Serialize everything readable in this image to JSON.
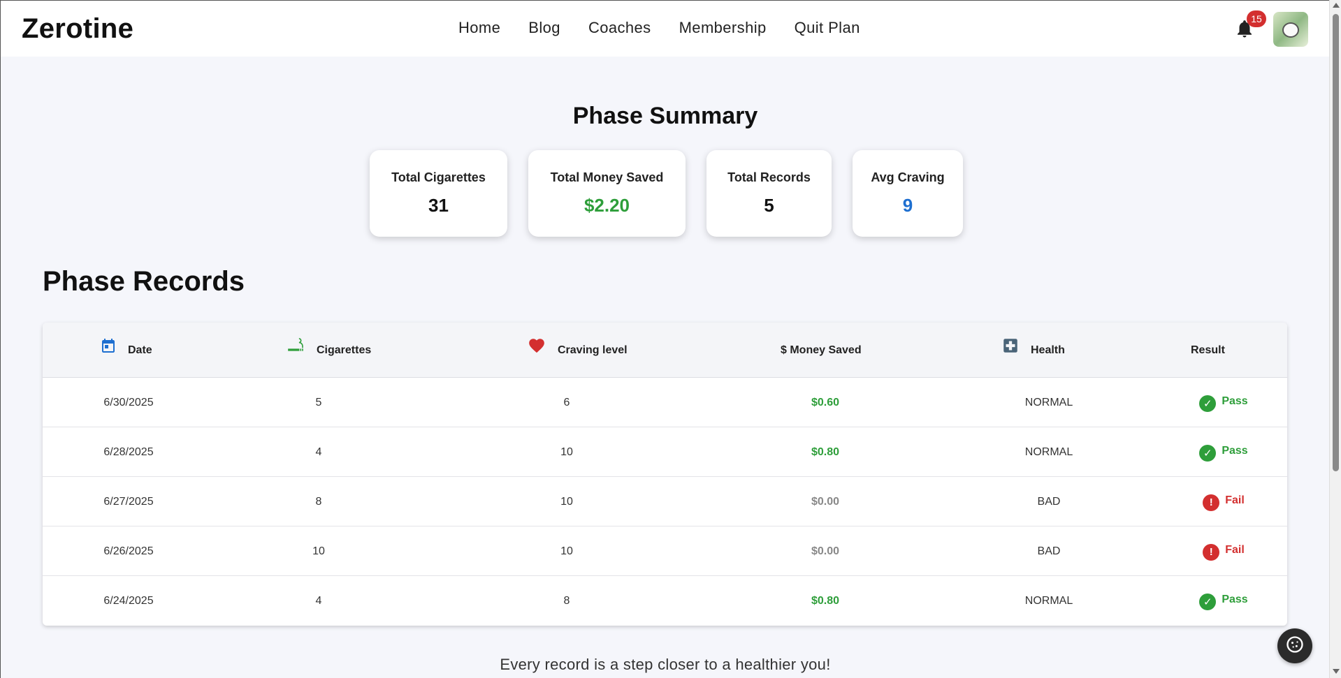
{
  "brand": {
    "logo": "Zerotine"
  },
  "nav": {
    "items": [
      {
        "label": "Home"
      },
      {
        "label": "Blog"
      },
      {
        "label": "Coaches"
      },
      {
        "label": "Membership"
      },
      {
        "label": "Quit Plan"
      }
    ]
  },
  "header": {
    "notification_count": "15"
  },
  "summary": {
    "title": "Phase Summary",
    "cards": [
      {
        "label": "Total Cigarettes",
        "value": "31"
      },
      {
        "label": "Total Money Saved",
        "value": "$2.20"
      },
      {
        "label": "Total Records",
        "value": "5"
      },
      {
        "label": "Avg Craving",
        "value": "9"
      }
    ]
  },
  "records": {
    "title": "Phase Records",
    "columns": {
      "date": "Date",
      "cigarettes": "Cigarettes",
      "craving": "Craving level",
      "money": "$ Money Saved",
      "health": "Health",
      "result": "Result"
    },
    "rows": [
      {
        "date": "6/30/2025",
        "cigarettes": "5",
        "craving": "6",
        "money": "$0.60",
        "health": "NORMAL",
        "result": "Pass"
      },
      {
        "date": "6/28/2025",
        "cigarettes": "4",
        "craving": "10",
        "money": "$0.80",
        "health": "NORMAL",
        "result": "Pass"
      },
      {
        "date": "6/27/2025",
        "cigarettes": "8",
        "craving": "10",
        "money": "$0.00",
        "health": "BAD",
        "result": "Fail"
      },
      {
        "date": "6/26/2025",
        "cigarettes": "10",
        "craving": "10",
        "money": "$0.00",
        "health": "BAD",
        "result": "Fail"
      },
      {
        "date": "6/24/2025",
        "cigarettes": "4",
        "craving": "8",
        "money": "$0.80",
        "health": "NORMAL",
        "result": "Pass"
      }
    ]
  },
  "footer": {
    "message": "Every record is a step closer to a healthier you!"
  },
  "colors": {
    "pass": "#2e9e3a",
    "fail": "#d32f2f",
    "accent_blue": "#1e6fd0",
    "background": "#f5f6fb"
  },
  "icons": {
    "date": "calendar-icon",
    "cigarettes": "cigarette-icon",
    "craving": "heart-icon",
    "health": "medical-cross-icon",
    "pass": "check-circle-icon",
    "fail": "alert-circle-icon",
    "fab": "cookie-icon"
  }
}
